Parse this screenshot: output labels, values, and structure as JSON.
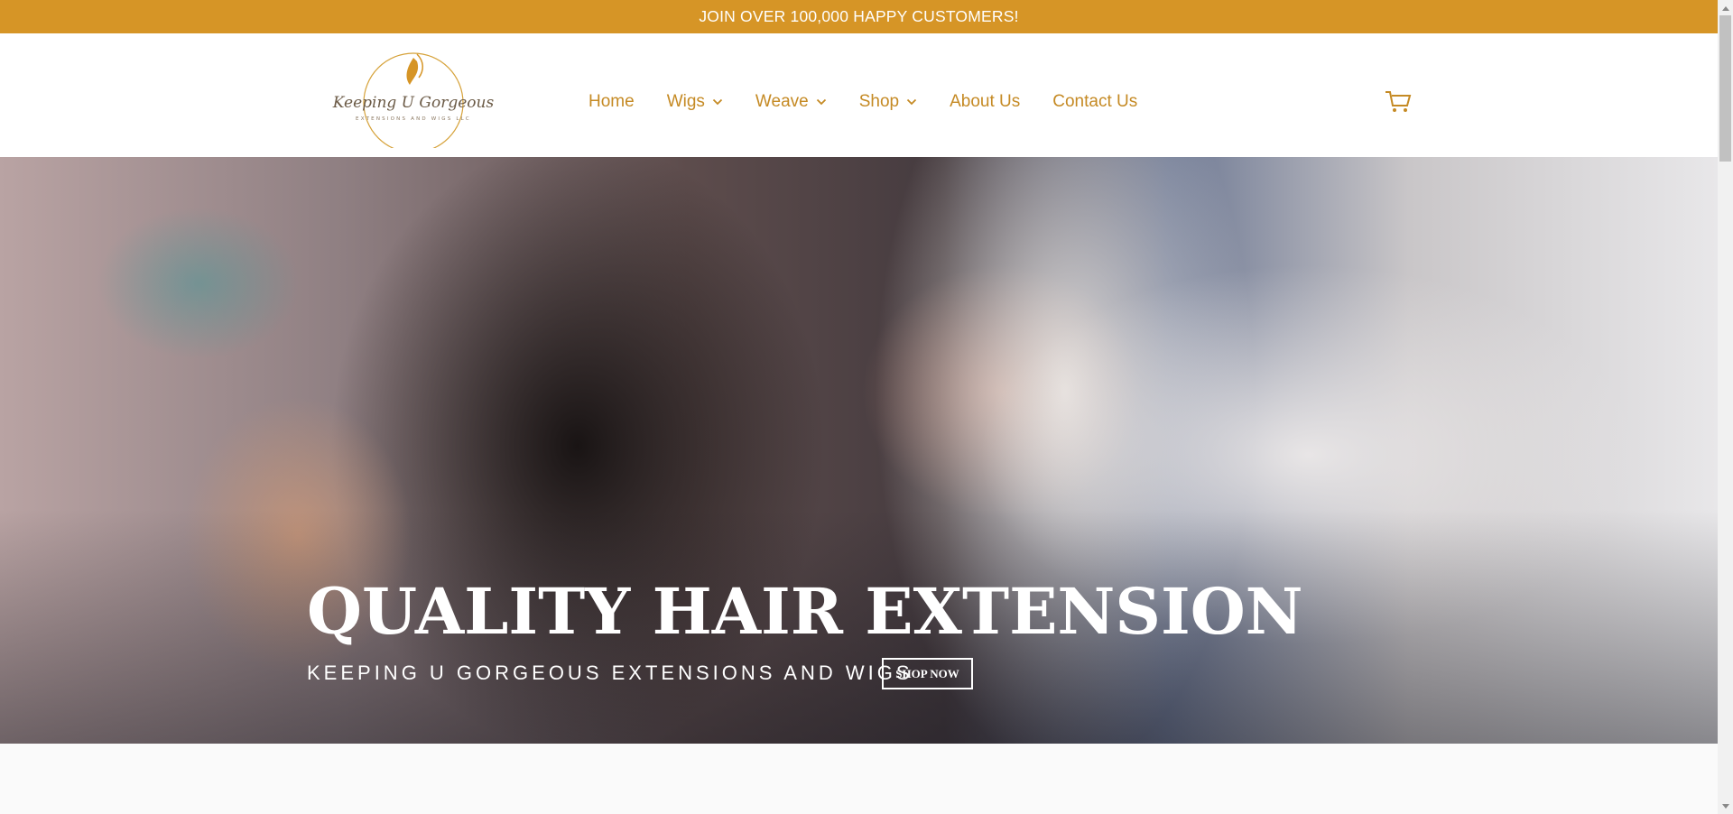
{
  "announcement": {
    "text": "JOIN OVER 100,000 HAPPY CUSTOMERS!"
  },
  "header": {
    "logo": {
      "script_text": "Keeping U Gorgeous",
      "tagline": "EXTENSIONS AND WIGS LLC"
    },
    "nav": [
      {
        "label": "Home",
        "has_dropdown": false
      },
      {
        "label": "Wigs",
        "has_dropdown": true
      },
      {
        "label": "Weave",
        "has_dropdown": true
      },
      {
        "label": "Shop",
        "has_dropdown": true
      },
      {
        "label": "About Us",
        "has_dropdown": false
      },
      {
        "label": "Contact Us",
        "has_dropdown": false
      }
    ],
    "cart_icon": "cart-icon"
  },
  "hero": {
    "title": "QUALITY HAIR EXTENSION",
    "subtitle": "KEEPING U GORGEOUS EXTENSIONS AND WIGS",
    "button_label": "SHOP NOW"
  },
  "colors": {
    "announcement_bg": "#d69526",
    "nav_text": "#c58a24",
    "hero_text": "#ffffff"
  }
}
